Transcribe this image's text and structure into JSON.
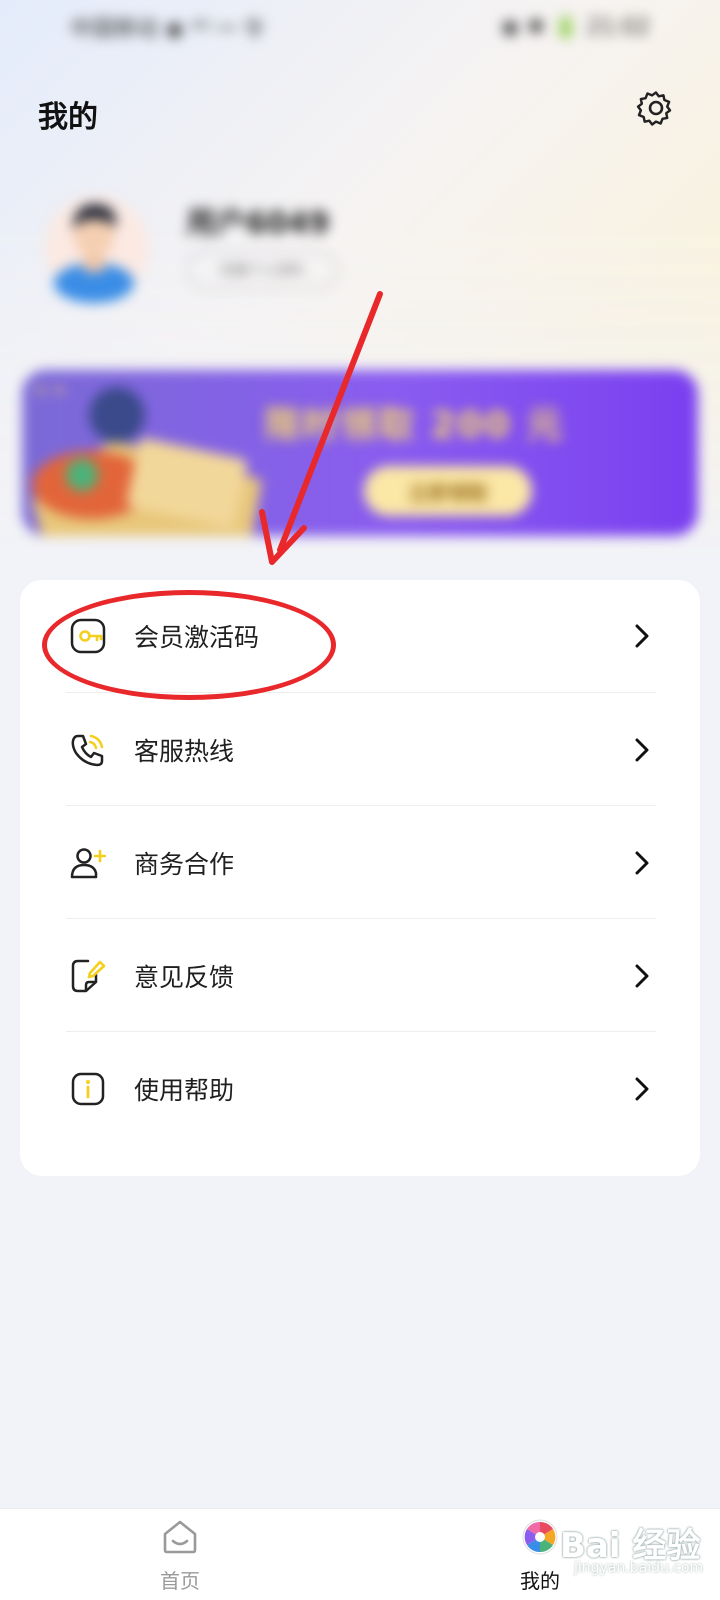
{
  "colors": {
    "accent": "#f5cf1e",
    "annotation_red": "#e8282b",
    "banner_purple": "#8a5cf0",
    "banner_gold": "#f6d66b"
  },
  "status_bar": {
    "left": "中国移动 ◉ ⁴ᴳ ꟷ 令",
    "right": "◉ ✱ 🔋 21:02"
  },
  "header": {
    "title": "我的",
    "settings_icon": "gear-icon"
  },
  "profile": {
    "username": "用户6049",
    "pill": "完善个人资料"
  },
  "banner": {
    "title": "限时领取 200 元",
    "button": "立即领取"
  },
  "menu": [
    {
      "label": "会员激活码",
      "icon": "key-icon"
    },
    {
      "label": "客服热线",
      "icon": "phone-icon"
    },
    {
      "label": "商务合作",
      "icon": "add-user-icon"
    },
    {
      "label": "意见反馈",
      "icon": "feedback-icon"
    },
    {
      "label": "使用帮助",
      "icon": "info-icon"
    }
  ],
  "tabs": [
    {
      "label": "首页",
      "icon": "home-icon",
      "active": false
    },
    {
      "label": "我的",
      "icon": "profile-tab-icon",
      "active": true
    }
  ],
  "watermark": {
    "brand": "Bai 经验",
    "url": "jingyan.baidu.com"
  }
}
